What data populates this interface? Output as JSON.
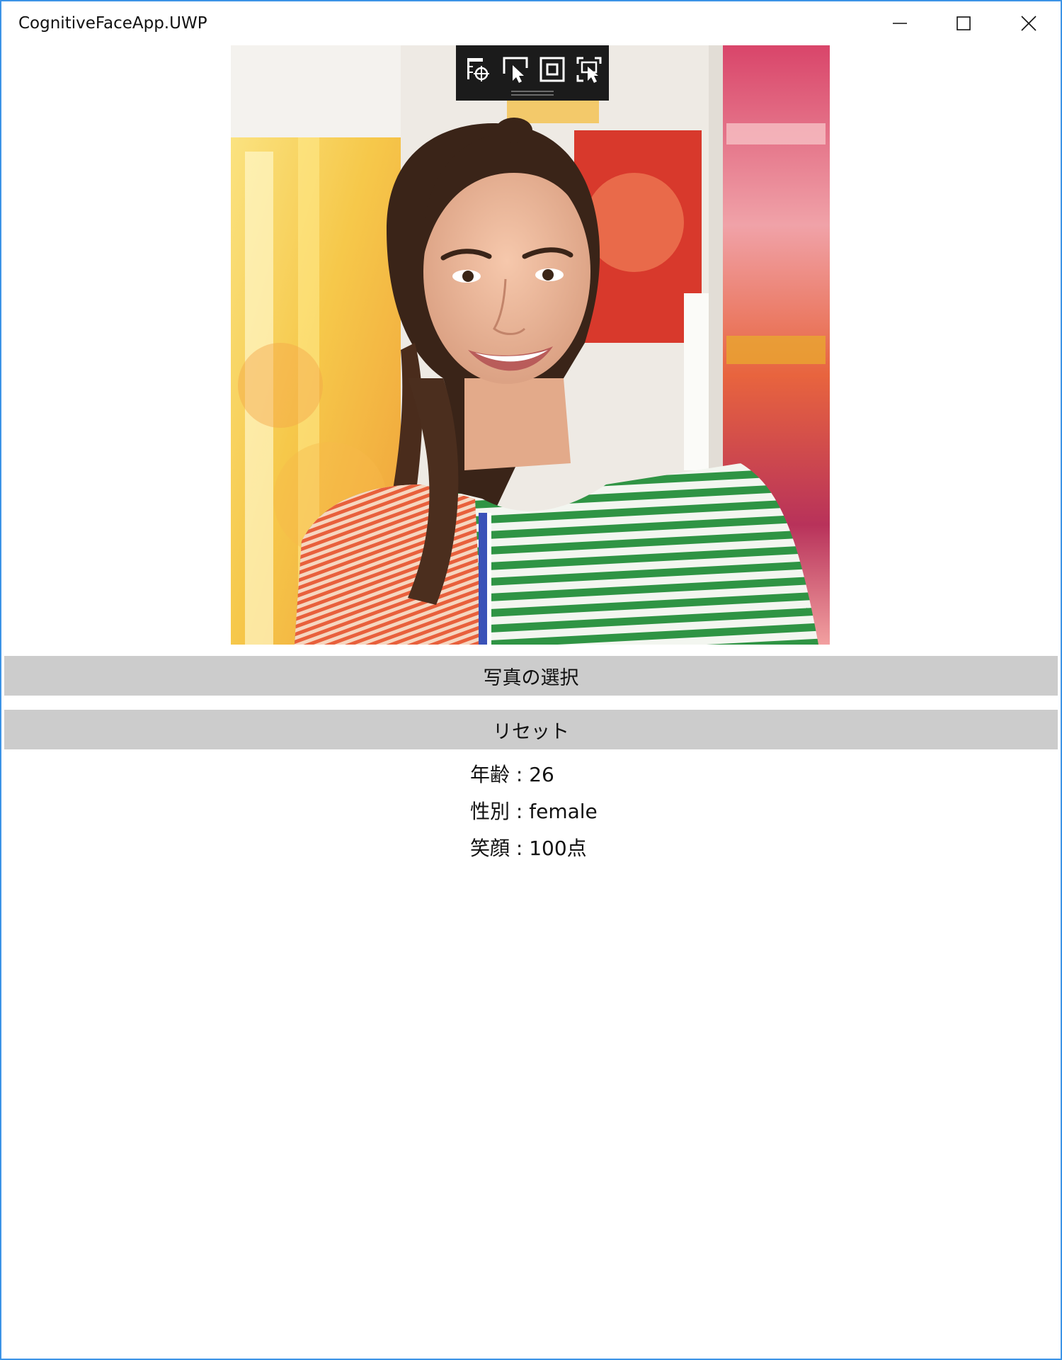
{
  "window": {
    "title": "CognitiveFaceApp.UWP",
    "accent_border": "#3c93e6",
    "controls": {
      "minimize_icon": "minimize-icon",
      "maximize_icon": "maximize-icon",
      "close_icon": "close-icon"
    }
  },
  "debug_toolbar": {
    "background": "#1b1b1b",
    "tools": [
      "live-visual-tree-icon",
      "select-element-icon",
      "display-layout-adorners-icon",
      "track-focused-element-icon"
    ]
  },
  "photo": {
    "subject": "smiling woman in striped shirt"
  },
  "buttons": {
    "select_photo": "写真の選択",
    "reset": "リセット",
    "background": "#cccccc"
  },
  "results": {
    "age": "年齢 : 26",
    "gender": "性別 : female",
    "smile": "笑顔 : 100点"
  }
}
